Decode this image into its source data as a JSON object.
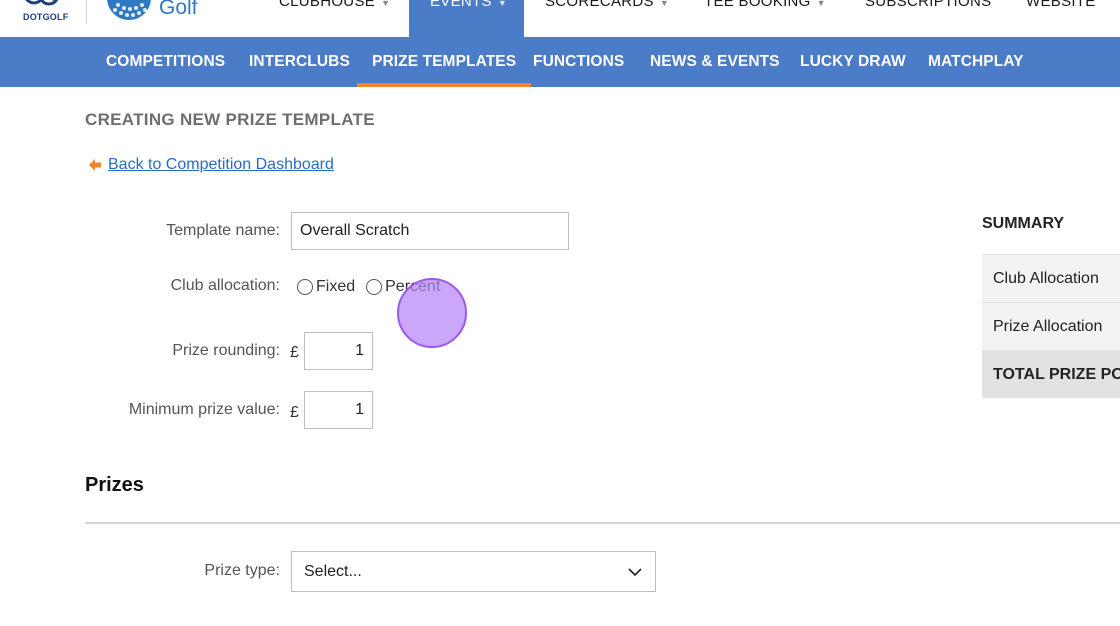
{
  "brand": {
    "name": "DOTGOLF",
    "product": "Golf"
  },
  "top_nav": {
    "items": [
      {
        "label": "CLUBHOUSE",
        "has_dropdown": true,
        "active": false
      },
      {
        "label": "EVENTS",
        "has_dropdown": true,
        "active": true
      },
      {
        "label": "SCORECARDS",
        "has_dropdown": true,
        "active": false
      },
      {
        "label": "TEE BOOKING",
        "has_dropdown": true,
        "active": false
      },
      {
        "label": "SUBSCRIPTIONS",
        "has_dropdown": false,
        "active": false
      },
      {
        "label": "WEBSITE",
        "has_dropdown": false,
        "active": false
      }
    ],
    "caret": "▼"
  },
  "sub_nav": {
    "items": [
      {
        "label": "COMPETITIONS"
      },
      {
        "label": "INTERCLUBS"
      },
      {
        "label": "PRIZE TEMPLATES"
      },
      {
        "label": "FUNCTIONS"
      },
      {
        "label": "NEWS & EVENTS"
      },
      {
        "label": "LUCKY DRAW"
      },
      {
        "label": "MATCHPLAY"
      }
    ],
    "active": "PRIZE TEMPLATES"
  },
  "page": {
    "title": "CREATING NEW PRIZE TEMPLATE",
    "back_link": "Back to Competition Dashboard"
  },
  "form": {
    "template_name": {
      "label": "Template name:",
      "value": "Overall Scratch"
    },
    "club_allocation": {
      "label": "Club allocation:",
      "options": [
        "Fixed",
        "Percent"
      ],
      "selected": null
    },
    "prize_rounding": {
      "label": "Prize rounding:",
      "currency": "£",
      "value": "1"
    },
    "minimum_prize_value": {
      "label": "Minimum prize value:",
      "currency": "£",
      "value": "1"
    }
  },
  "prizes": {
    "title": "Prizes",
    "prize_type": {
      "label": "Prize type:",
      "value": "Select..."
    }
  },
  "summary": {
    "title": "SUMMARY",
    "rows": [
      "Club Allocation",
      "Prize Allocation",
      "TOTAL PRIZE POT"
    ]
  },
  "colors": {
    "nav_blue": "#4a7cc7",
    "active_underline": "#f0852a",
    "link_blue": "#2a6cc1",
    "click_indicator": "#b482f5"
  }
}
